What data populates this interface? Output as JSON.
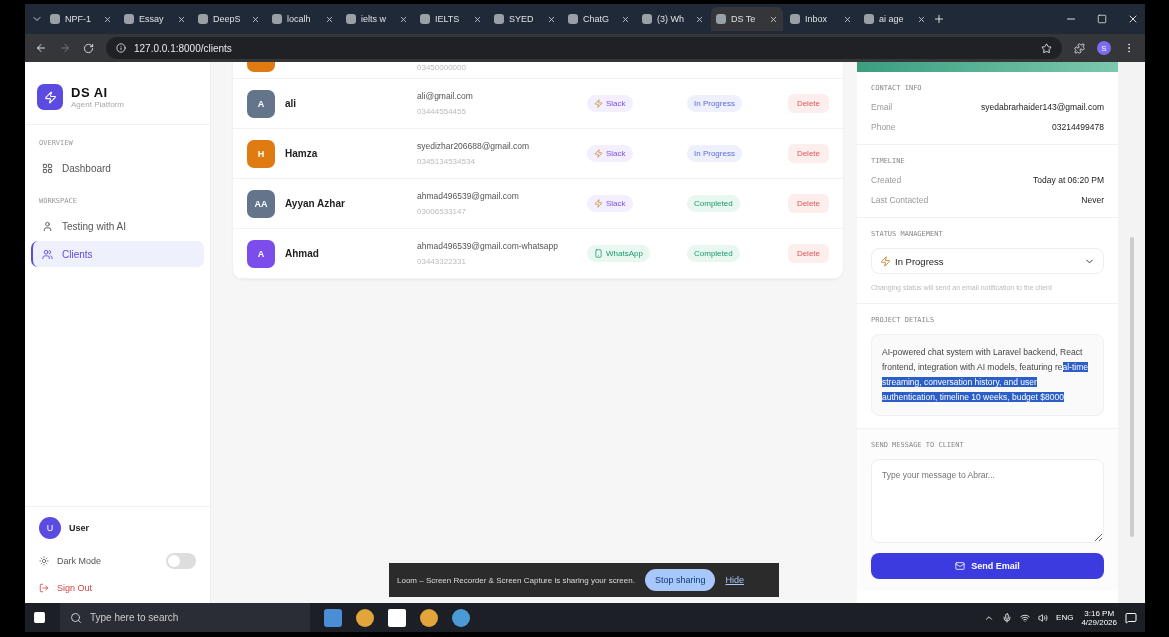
{
  "browser": {
    "tabs": [
      {
        "label": "NPF-1",
        "selected": false
      },
      {
        "label": "Essay",
        "selected": false
      },
      {
        "label": "DeepS",
        "selected": false
      },
      {
        "label": "localh",
        "selected": false
      },
      {
        "label": "ielts w",
        "selected": false
      },
      {
        "label": "IELTS",
        "selected": false
      },
      {
        "label": "SYED",
        "selected": false
      },
      {
        "label": "ChatG",
        "selected": false
      },
      {
        "label": "(3) Wh",
        "selected": false
      },
      {
        "label": "DS Te",
        "selected": true
      },
      {
        "label": "Inbox",
        "selected": false
      },
      {
        "label": "ai age",
        "selected": false
      }
    ],
    "url": "127.0.0.1:8000/clients",
    "profile_initial": "S"
  },
  "sidebar": {
    "brand": {
      "name": "DS AI",
      "tagline": "Agent Platform"
    },
    "sections": [
      {
        "title": "OVERVIEW",
        "items": [
          {
            "label": "Dashboard",
            "selected": false
          }
        ]
      },
      {
        "title": "WORKSPACE",
        "items": [
          {
            "label": "Testing with AI",
            "selected": false
          },
          {
            "label": "Clients",
            "selected": true
          }
        ]
      }
    ],
    "user": {
      "initial": "U",
      "name": "User"
    },
    "dark_mode": {
      "label": "Dark Mode",
      "on": false
    },
    "sign_out": "Sign Out"
  },
  "clients": [
    {
      "kind": "partial",
      "color": "#e07b12",
      "phone": "03450000000"
    },
    {
      "kind": "row",
      "initial": "A",
      "color": "#64748b",
      "name": "ali",
      "email": "ali@gmail.com",
      "phone": "03444554455",
      "channel": {
        "label": "Slack",
        "kind": "slack"
      },
      "status": {
        "label": "In Progress",
        "kind": "progress"
      },
      "action": "Delete"
    },
    {
      "kind": "row",
      "initial": "H",
      "color": "#e07b12",
      "name": "Hamza",
      "email": "syedizhar206688@gmail.com",
      "phone": "0345134534534",
      "channel": {
        "label": "Slack",
        "kind": "slack"
      },
      "status": {
        "label": "In Progress",
        "kind": "progress"
      },
      "action": "Delete"
    },
    {
      "kind": "row",
      "initial": "AA",
      "color": "#64748b",
      "name": "Ayyan Azhar",
      "email": "ahmad496539@gmail.com",
      "phone": "03006533147",
      "channel": {
        "label": "Slack",
        "kind": "slack"
      },
      "status": {
        "label": "Completed",
        "kind": "completed"
      },
      "action": "Delete"
    },
    {
      "kind": "row",
      "initial": "A",
      "color": "#7c4dea",
      "name": "Ahmad",
      "email": "ahmad496539@gmail.com-whatsapp",
      "phone": "03443322331",
      "channel": {
        "label": "WhatsApp",
        "kind": "whatsapp"
      },
      "status": {
        "label": "Completed",
        "kind": "completed"
      },
      "action": "Delete"
    }
  ],
  "details": {
    "contact": {
      "title": "CONTACT INFO",
      "rows": [
        {
          "label": "Email",
          "value": "syedabrarhaider143@gmail.com"
        },
        {
          "label": "Phone",
          "value": "03214499478"
        }
      ]
    },
    "timeline": {
      "title": "TIMELINE",
      "rows": [
        {
          "label": "Created",
          "value": "Today at 06:20 PM"
        },
        {
          "label": "Last Contacted",
          "value": "Never"
        }
      ]
    },
    "status": {
      "title": "STATUS MANAGEMENT",
      "value": "In Progress",
      "hint": "Changing status will send an email notification to the client"
    },
    "project": {
      "title": "PROJECT DETAILS",
      "text": "AI-powered chat system with Laravel backend, React frontend, integration with AI models, featuring re",
      "selected_text": "al-time streaming, conversation history, and user authentication, timeline 10 weeks, budget $8000"
    },
    "message": {
      "title": "SEND MESSAGE TO CLIENT",
      "placeholder": "Type your message to Abrar...",
      "button": "Send Email"
    }
  },
  "share_bar": {
    "text": "Loom – Screen Recorder & Screen Capture is sharing your screen.",
    "stop": "Stop sharing",
    "hide": "Hide"
  },
  "taskbar": {
    "search_placeholder": "Type here to search",
    "language": "ENG",
    "time": "3:16 PM",
    "date": "4/29/2026"
  }
}
